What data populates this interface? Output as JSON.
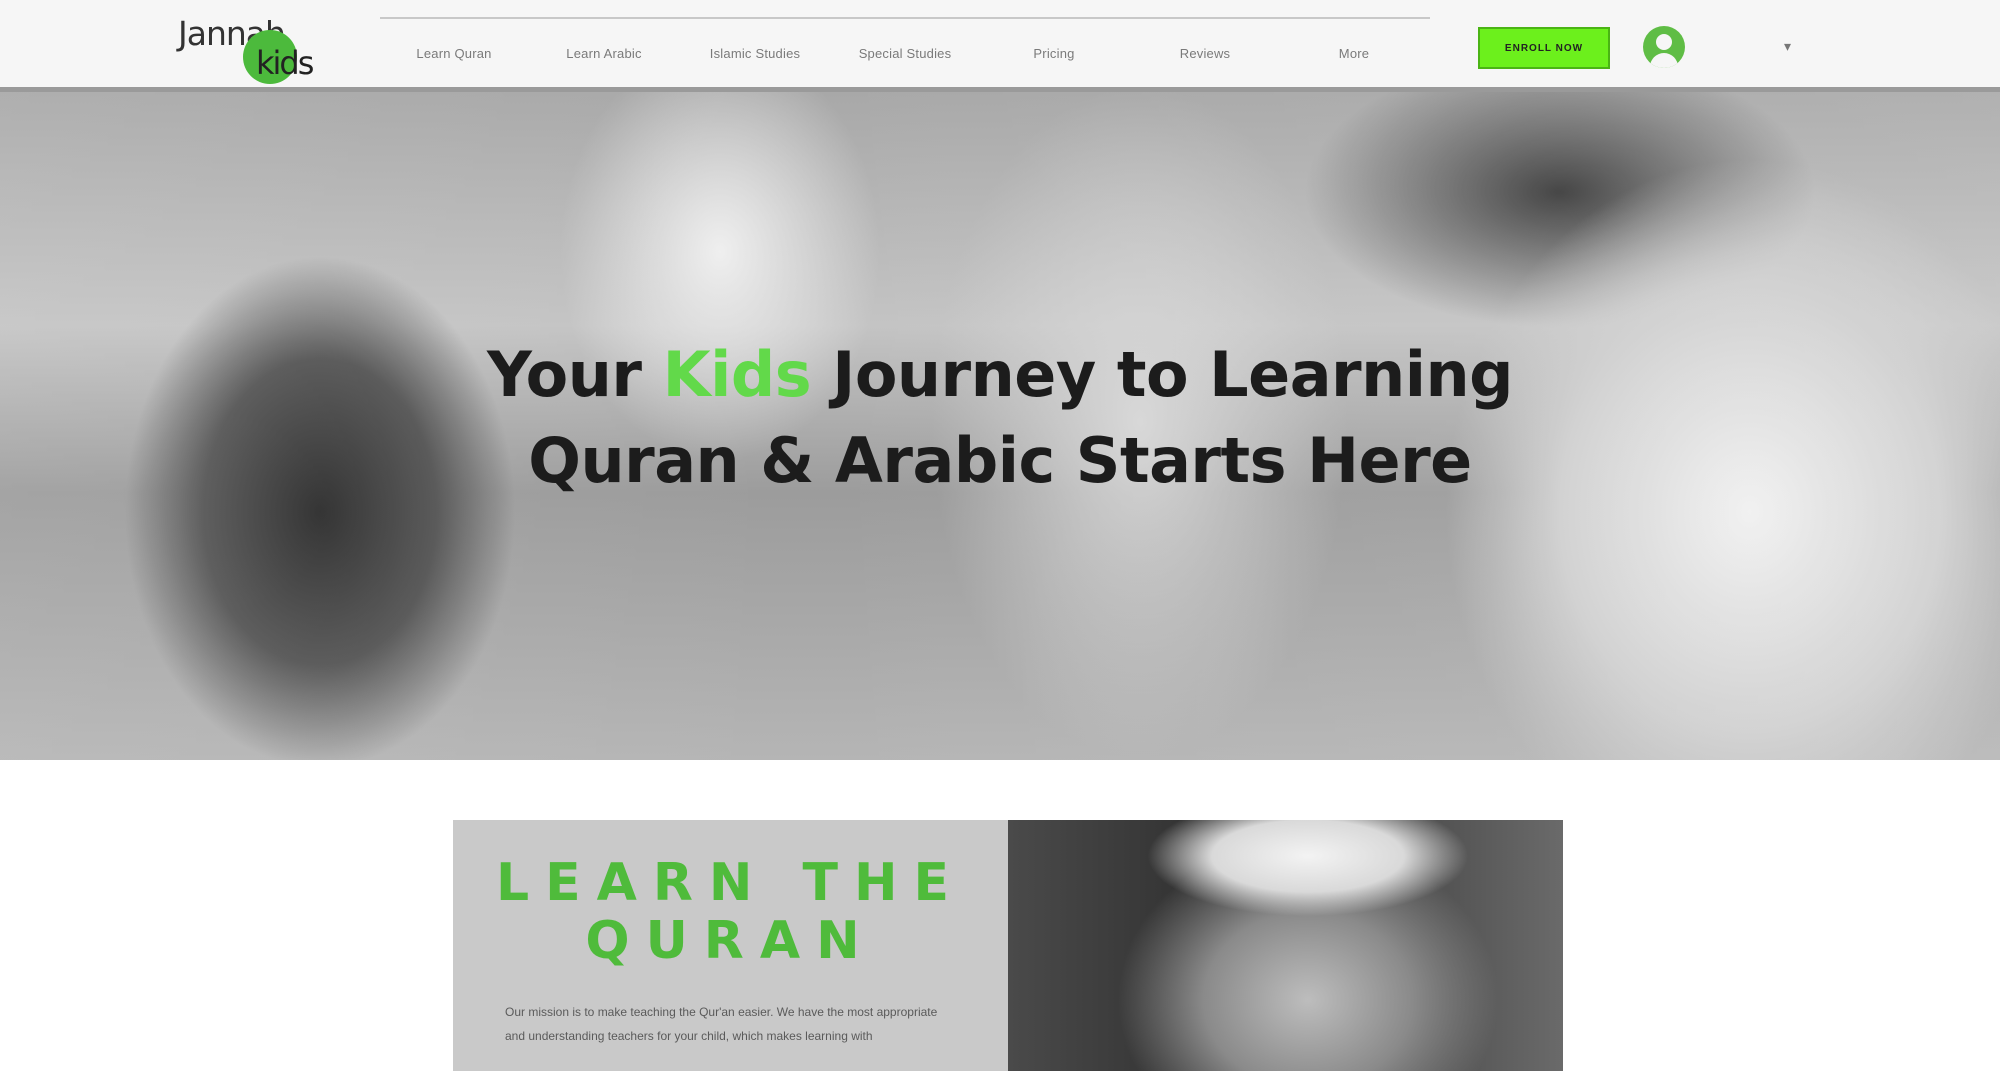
{
  "logo": {
    "text": "Jannah",
    "kids": "kids"
  },
  "nav": {
    "items": [
      {
        "label": "Learn Quran"
      },
      {
        "label": "Learn Arabic"
      },
      {
        "label": "Islamic Studies"
      },
      {
        "label": "Special Studies"
      },
      {
        "label": "Pricing"
      },
      {
        "label": "Reviews"
      },
      {
        "label": "More"
      }
    ]
  },
  "header": {
    "enroll_label": "ENROLL NOW"
  },
  "hero": {
    "title_pre": "Your ",
    "title_accent": "Kids",
    "title_post": " Journey to Learning",
    "title_line2": "Quran & Arabic Starts Here"
  },
  "card": {
    "title_line1": "LEARN THE",
    "title_line2": "QURAN",
    "body": "Our mission is to make teaching the Qur'an easier. We have the most appropriate and understanding teachers for your child, which makes learning with"
  },
  "colors": {
    "accent_green": "#62d94a",
    "button_green": "#6cf01c",
    "title_green": "#4fbb3b"
  },
  "icons": {
    "avatar": "user-avatar-icon",
    "chevron": "chevron-down-icon"
  }
}
